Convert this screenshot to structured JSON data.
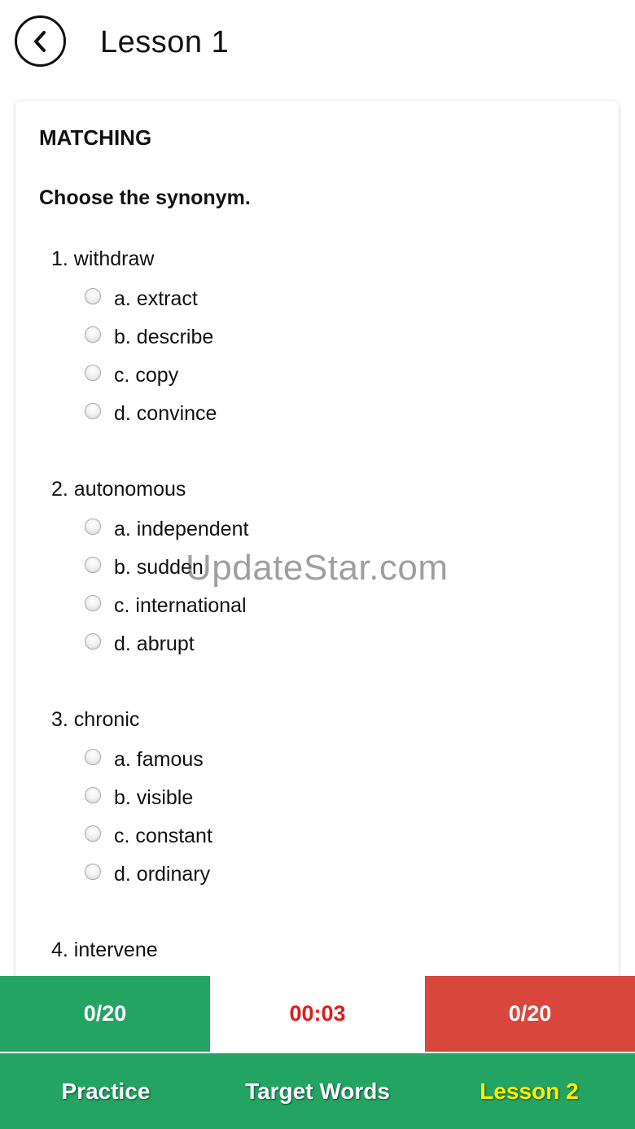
{
  "header": {
    "back_icon": "chevron-left-icon",
    "title": "Lesson 1"
  },
  "card": {
    "section_title": "MATCHING",
    "instruction": "Choose the synonym.",
    "questions": [
      {
        "text": "1. withdraw",
        "options": [
          "a. extract",
          "b. describe",
          "c. copy",
          "d. convince"
        ]
      },
      {
        "text": "2. autonomous",
        "options": [
          "a. independent",
          "b. sudden",
          "c. international",
          "d. abrupt"
        ]
      },
      {
        "text": "3. chronic",
        "options": [
          "a. famous",
          "b. visible",
          "c. constant",
          "d. ordinary"
        ]
      },
      {
        "text": "4. intervene",
        "options": []
      }
    ]
  },
  "score_bar": {
    "correct": "0/20",
    "timer": "00:03",
    "wrong": "0/20",
    "colors": {
      "correct_bg": "#23a463",
      "wrong_bg": "#d9463c",
      "timer_text": "#e21b1b"
    }
  },
  "nav": {
    "items": [
      {
        "label": "Practice",
        "active": false
      },
      {
        "label": "Target Words",
        "active": false
      },
      {
        "label": "Lesson 2",
        "active": true
      }
    ],
    "colors": {
      "bg": "#23a463",
      "text": "#ffffff",
      "active_text": "#ffee00"
    }
  },
  "watermark": "UpdateStar.com"
}
